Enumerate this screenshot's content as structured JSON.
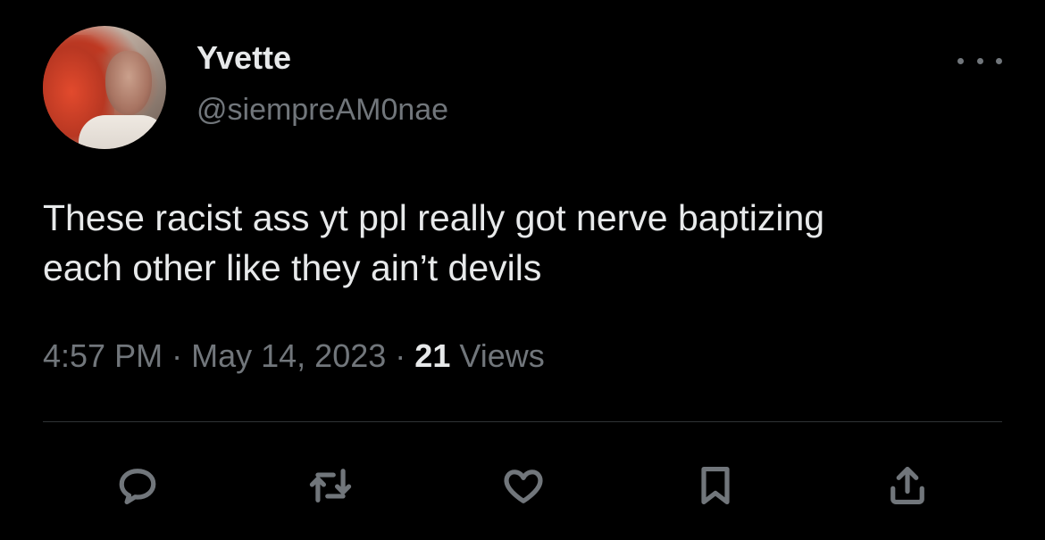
{
  "author": {
    "name": "Yvette",
    "handle": "@siempreAM0nae",
    "avatar_icon": "profile-photo"
  },
  "more_icon": "more-horizontal-icon",
  "tweet": {
    "text": "These racist ass yt ppl really got nerve baptizing\neach other like they ain’t devils",
    "time": "4:57 PM",
    "separator": "·",
    "date": "May 14, 2023",
    "views_count": "21",
    "views_label": "Views"
  },
  "actions": [
    {
      "name": "reply",
      "icon": "reply-icon"
    },
    {
      "name": "retweet",
      "icon": "retweet-icon"
    },
    {
      "name": "like",
      "icon": "heart-icon"
    },
    {
      "name": "bookmark",
      "icon": "bookmark-icon"
    },
    {
      "name": "share",
      "icon": "share-icon"
    }
  ],
  "colors": {
    "background": "#000000",
    "primary_text": "#e7e9ea",
    "secondary_text": "#71767b",
    "divider": "#2f3336"
  }
}
